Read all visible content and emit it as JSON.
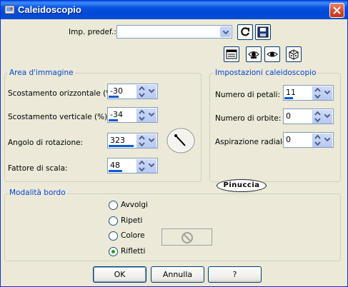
{
  "window": {
    "title": "Caleidoscopio"
  },
  "preset": {
    "label": "Imp. predef.:",
    "value": ""
  },
  "toolbar": {
    "icons": [
      "reset-icon",
      "save-preset-icon",
      "dialog-settings-icon",
      "preview-eye-icon",
      "eye-toggle-icon",
      "randomize-dice-icon"
    ]
  },
  "image_area": {
    "title": "Area d'immagine",
    "fields": [
      {
        "label": "Scostamento orizzontale (%):",
        "value": "-30",
        "fill": 0.35
      },
      {
        "label": "Scostamento verticale (%):",
        "value": "-34",
        "fill": 0.33
      },
      {
        "label": "Angolo di rotazione:",
        "value": "323",
        "fill": 0.9
      },
      {
        "label": "Fattore di scala:",
        "value": "48",
        "fill": 0.48
      }
    ]
  },
  "kaleido": {
    "title": "Impostazioni caleidoscopio",
    "fields": [
      {
        "label": "Numero di petali:",
        "value": "11",
        "fill": 0.3
      },
      {
        "label": "Numero di orbite:",
        "value": "0",
        "fill": 0
      },
      {
        "label": "Aspirazione radiale:",
        "value": "0",
        "fill": 0
      }
    ]
  },
  "watermark": "Pinuccia",
  "edge_mode": {
    "title": "Modalità bordo",
    "options": [
      {
        "label": "Avvolgi",
        "selected": false
      },
      {
        "label": "Ripeti",
        "selected": false
      },
      {
        "label": "Colore",
        "selected": false
      },
      {
        "label": "Rifletti",
        "selected": true
      }
    ]
  },
  "buttons": {
    "ok": "OK",
    "cancel": "Annulla",
    "help": "?"
  }
}
